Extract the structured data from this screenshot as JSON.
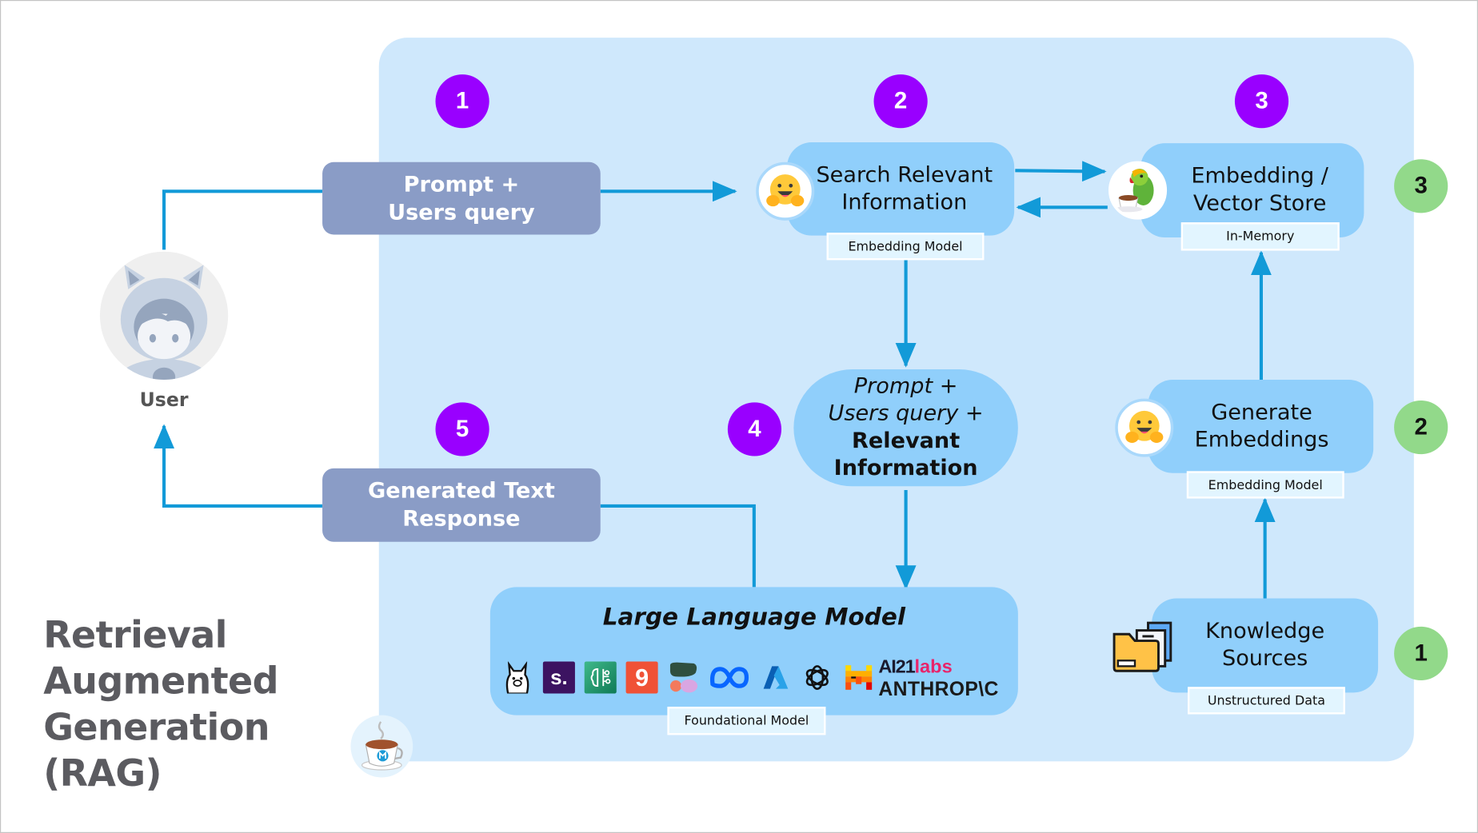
{
  "title": {
    "lines": [
      "Retrieval",
      "Augmented",
      "Generation",
      "(RAG)"
    ]
  },
  "user": {
    "label": "User",
    "icon": "astro-avatar-icon"
  },
  "flow_steps": {
    "purple": [
      "1",
      "2",
      "3",
      "4",
      "5"
    ],
    "green": [
      "1",
      "2",
      "3"
    ]
  },
  "nodes": {
    "prompt_query": {
      "lines": [
        "Prompt +",
        "Users query"
      ]
    },
    "generated_response": {
      "lines": [
        "Generated Text",
        "Response"
      ]
    },
    "search": {
      "lines": [
        "Search Relevant",
        "Information"
      ],
      "tag": "Embedding Model",
      "icon": "hugging-face-icon"
    },
    "vector_store": {
      "lines": [
        "Embedding /",
        "Vector Store"
      ],
      "tag": "In-Memory",
      "icon": "parrot-teacup-icon"
    },
    "augmented_prompt": {
      "italic_lines": [
        "Prompt +",
        "Users query +"
      ],
      "bold_lines": [
        "Relevant",
        "Information"
      ]
    },
    "llm": {
      "title": "Large Language Model",
      "tag": "Foundational  Model",
      "providers": [
        "ollama",
        "stability",
        "openai-compatible",
        "gradient",
        "groq",
        "meta",
        "azure",
        "openai",
        "mistral",
        "ai21labs",
        "anthropic"
      ],
      "ai21_text": "AI21",
      "ai21_labs": "labs",
      "anthropic_text": "ANTHROP\\C",
      "stability_letter": "s.",
      "gradient_letter": "9"
    },
    "generate_embeddings": {
      "lines": [
        "Generate",
        "Embeddings"
      ],
      "tag": "Embedding Model",
      "icon": "hugging-face-icon"
    },
    "knowledge_sources": {
      "lines": [
        "Knowledge",
        "Sources"
      ],
      "tag": "Unstructured Data",
      "icon": "folder-documents-icon"
    }
  },
  "colors": {
    "panel": "#cfe8fc",
    "node": "#90cffb",
    "user_box": "#8a9cc6",
    "arrow": "#129ad8",
    "step_purple": "#9900ff",
    "step_green": "#92d98a",
    "title": "#5b5b60"
  },
  "footer_icon": "mulesoft-coffee-icon"
}
